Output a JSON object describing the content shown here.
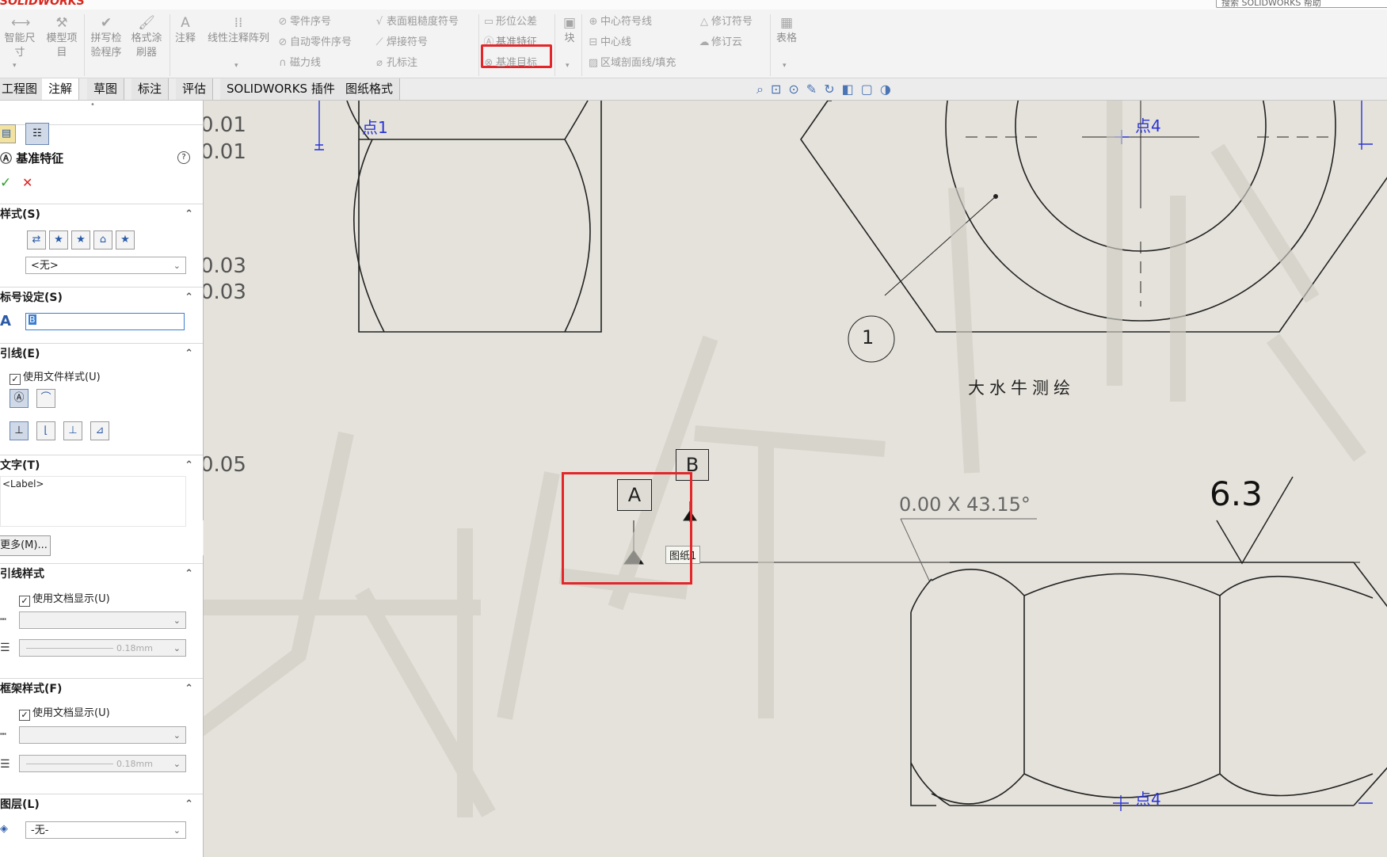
{
  "app": {
    "logo": "SOLIDWORKS",
    "search_placeholder": "搜索 SOLIDWORKS 帮助"
  },
  "ribbon": {
    "smart_dim": "智能尺寸",
    "model_items": "模型项目",
    "spell_check": "拼写检验程序",
    "format_painter": "格式涂刷器",
    "note": "注释",
    "linear_note_pattern": "线性注释阵列",
    "balloon": "零件序号",
    "auto_balloon": "自动零件序号",
    "magnetic_line": "磁力线",
    "surface_finish": "表面粗糙度符号",
    "weld_symbol": "焊接符号",
    "hole_callout": "孔标注",
    "gtol": "形位公差",
    "datum_feature": "基准特征",
    "datum_target": "基准目标",
    "block": "块",
    "center_mark": "中心符号线",
    "centerline": "中心线",
    "hatch": "区域剖面线/填充",
    "revision_symbol": "修订符号",
    "revision_cloud": "修订云",
    "table": "表格"
  },
  "tabs": [
    "工程图",
    "注解",
    "草图",
    "标注",
    "评估",
    "SOLIDWORKS 插件",
    "图纸格式"
  ],
  "active_tab": "注解",
  "panel": {
    "title": "基准特征",
    "style_section": "样式(S)",
    "style_value": "<无>",
    "label_section": "标号设定(S)",
    "label_value": "B",
    "leader_section": "引线(E)",
    "use_file_style": "使用文件样式(U)",
    "text_section": "文字(T)",
    "text_value": "<Label>",
    "more_button": "更多(M)...",
    "leader_style_section": "引线样式",
    "use_doc_display_1": "使用文档显示(U)",
    "line_width_1": "0.18mm",
    "frame_style_section": "框架样式(F)",
    "use_doc_display_2": "使用文档显示(U)",
    "line_width_2": "0.18mm",
    "layer_section": "图层(L)",
    "layer_value": "-无-"
  },
  "drawing": {
    "dim_values": [
      "0.01",
      "0.01",
      "0.03",
      "0.03",
      "0.05"
    ],
    "point_labels": [
      "点1",
      "点4",
      "点4"
    ],
    "balloon_number": "1",
    "watermark_note": "大水牛测绘",
    "chamfer_dim": "0.00 X 43.15°",
    "roughness_value": "6.3",
    "datum_a": "A",
    "datum_b": "B",
    "sheet_tooltip": "图纸1",
    "watermark": "大水牛测绘"
  }
}
